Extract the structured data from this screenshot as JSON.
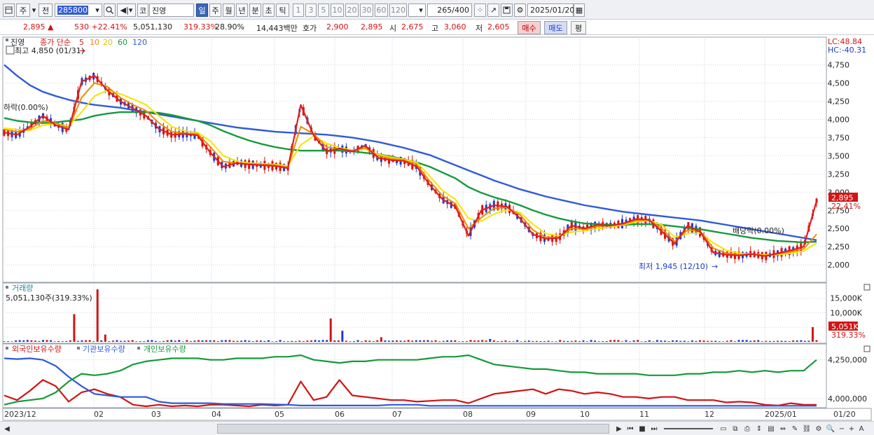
{
  "toolbar": {
    "period_label": "주",
    "prev_label": "전",
    "code_value": "285800",
    "market_label": "코",
    "stock_name": "진영",
    "tabs": [
      "일",
      "주",
      "월",
      "년",
      "분",
      "초",
      "틱"
    ],
    "active_tab": "일",
    "intervals": [
      "1",
      "3",
      "5",
      "10",
      "20",
      "30",
      "60",
      "120"
    ],
    "count_display": "265",
    "count_total": "/400",
    "date_value": "2025/01/20"
  },
  "quote": {
    "price": "2,895 ▲",
    "change": "530 +22.41%",
    "volume": "5,051,130",
    "volume_ratio": "319.33%",
    "turnover": "28.90%",
    "trade_value": "14,443백만",
    "ask_label": "호가",
    "ask_price": "2,900",
    "bid_price": "2,895",
    "open_label": "시",
    "open": "2,675",
    "high_label": "고",
    "high": "3,060",
    "low_label": "저",
    "low": "2,605",
    "buy_label": "매수",
    "sell_label": "매도",
    "eval_label": "평"
  },
  "price_panel": {
    "title": "진영",
    "legend_prefix": "종가 단순",
    "ma_periods": [
      "5",
      "10",
      "20",
      "60",
      "120"
    ],
    "ma_colors": [
      "#e21e1e",
      "#f08a00",
      "#f5e400",
      "#179a3c",
      "#2f5bd8"
    ],
    "high_marker": "최고 4,850 (01/31)",
    "low_marker": "최저 1,945 (12/10)",
    "down_marker": "하락(0.00%)",
    "div_marker": "배당락(0.00%)",
    "lc": "LC:48.84",
    "hc": "HC:-40.31",
    "price_tag": "2,895",
    "pct_tag": "22.41%"
  },
  "volume_panel": {
    "title": "거래량",
    "reading": "5,051,130주(319.33%)",
    "vol_tag": "5,051K",
    "pct_tag": "319.33%"
  },
  "holdings_panel": {
    "legend": [
      {
        "label": "외국인보유수량",
        "color": "#d11414"
      },
      {
        "label": "기관보유수량",
        "color": "#2f5bd8"
      },
      {
        "label": "개인보유수량",
        "color": "#179a3c"
      }
    ]
  },
  "x_axis": {
    "labels": [
      "2023/12",
      "02",
      "03",
      "04",
      "05",
      "06",
      "07",
      "08",
      "09",
      "10",
      "11",
      "12",
      "2025/01"
    ],
    "right_label": "01/20"
  },
  "chart_data": [
    {
      "type": "line",
      "title": "진영",
      "y_ticks": [
        4750,
        4500,
        4250,
        4000,
        3750,
        3500,
        3250,
        3000,
        2750,
        2500,
        2250,
        2000
      ],
      "ylim": [
        1780,
        4900
      ],
      "series": [
        {
          "name": "5",
          "color": "#e21e1e",
          "values": [
            3820,
            3790,
            3900,
            4050,
            3920,
            3860,
            4520,
            4600,
            4400,
            4250,
            4150,
            4050,
            3870,
            3790,
            3800,
            3780,
            3540,
            3350,
            3400,
            3380,
            3370,
            3360,
            3330,
            4200,
            3780,
            3560,
            3600,
            3560,
            3640,
            3470,
            3440,
            3430,
            3350,
            3100,
            2900,
            2800,
            2400,
            2750,
            2820,
            2800,
            2640,
            2420,
            2360,
            2370,
            2540,
            2500,
            2550,
            2540,
            2570,
            2630,
            2620,
            2460,
            2290,
            2540,
            2450,
            2170,
            2140,
            2130,
            2150,
            2120,
            2160,
            2200,
            2250,
            2880
          ]
        },
        {
          "name": "10",
          "color": "#f08a00",
          "values": [
            3860,
            3830,
            3870,
            3980,
            3950,
            3880,
            4300,
            4500,
            4450,
            4300,
            4200,
            4120,
            3950,
            3830,
            3810,
            3800,
            3620,
            3420,
            3400,
            3390,
            3380,
            3370,
            3340,
            3900,
            3800,
            3620,
            3590,
            3570,
            3610,
            3500,
            3460,
            3440,
            3380,
            3150,
            2950,
            2840,
            2500,
            2650,
            2780,
            2790,
            2690,
            2480,
            2380,
            2380,
            2500,
            2490,
            2530,
            2540,
            2560,
            2610,
            2620,
            2500,
            2320,
            2480,
            2460,
            2230,
            2160,
            2140,
            2150,
            2130,
            2150,
            2180,
            2220,
            2420
          ]
        },
        {
          "name": "20",
          "color": "#f5e400",
          "values": [
            3880,
            3860,
            3850,
            3920,
            3940,
            3910,
            4100,
            4320,
            4400,
            4350,
            4280,
            4200,
            4050,
            3900,
            3840,
            3820,
            3700,
            3500,
            3430,
            3400,
            3390,
            3380,
            3360,
            3650,
            3770,
            3670,
            3610,
            3580,
            3590,
            3520,
            3480,
            3450,
            3410,
            3220,
            3020,
            2900,
            2640,
            2600,
            2700,
            2760,
            2720,
            2560,
            2430,
            2400,
            2450,
            2470,
            2500,
            2520,
            2550,
            2590,
            2610,
            2550,
            2380,
            2430,
            2440,
            2300,
            2200,
            2160,
            2150,
            2140,
            2140,
            2160,
            2190,
            2300
          ]
        },
        {
          "name": "60",
          "color": "#179a3c",
          "values": [
            4020,
            3980,
            3960,
            3950,
            3960,
            3980,
            4000,
            4050,
            4080,
            4100,
            4100,
            4100,
            4090,
            4060,
            4020,
            3980,
            3920,
            3840,
            3770,
            3710,
            3660,
            3620,
            3590,
            3570,
            3570,
            3570,
            3570,
            3560,
            3540,
            3520,
            3490,
            3450,
            3410,
            3350,
            3270,
            3190,
            3070,
            2990,
            2930,
            2880,
            2820,
            2750,
            2690,
            2640,
            2600,
            2570,
            2560,
            2550,
            2550,
            2560,
            2560,
            2550,
            2530,
            2510,
            2490,
            2460,
            2430,
            2400,
            2370,
            2350,
            2330,
            2320,
            2310,
            2320
          ]
        },
        {
          "name": "120",
          "color": "#2f5bd8",
          "values": [
            4750,
            4600,
            4470,
            4380,
            4320,
            4270,
            4230,
            4200,
            4180,
            4160,
            4130,
            4100,
            4070,
            4040,
            4010,
            3980,
            3950,
            3920,
            3890,
            3870,
            3850,
            3830,
            3820,
            3810,
            3800,
            3790,
            3770,
            3750,
            3720,
            3690,
            3650,
            3610,
            3560,
            3510,
            3440,
            3370,
            3300,
            3230,
            3160,
            3100,
            3040,
            2990,
            2940,
            2900,
            2860,
            2820,
            2790,
            2760,
            2730,
            2710,
            2690,
            2670,
            2650,
            2630,
            2610,
            2580,
            2550,
            2520,
            2490,
            2460,
            2430,
            2400,
            2370,
            2340
          ]
        }
      ]
    },
    {
      "type": "bar",
      "title": "거래량",
      "y_ticks": [
        5000,
        10000,
        15000
      ],
      "y_tick_labels": [
        "5,000",
        "10,000K",
        "15,000K"
      ],
      "ylim": [
        0,
        18500
      ],
      "spikes": [
        {
          "i": 18,
          "v": 9500,
          "c": "#d11414"
        },
        {
          "i": 24,
          "v": 18000,
          "c": "#d11414"
        },
        {
          "i": 26,
          "v": 2500,
          "c": "#d11414"
        },
        {
          "i": 84,
          "v": 8000,
          "c": "#d11414"
        },
        {
          "i": 87,
          "v": 3800,
          "c": "#1f3cc9"
        },
        {
          "i": 97,
          "v": 1600,
          "c": "#d11414"
        },
        {
          "i": 125,
          "v": 1000,
          "c": "#1f3cc9"
        },
        {
          "i": 208,
          "v": 5051,
          "c": "#d11414"
        }
      ]
    },
    {
      "type": "line",
      "title": "보유수량",
      "y_ticks": [
        4000000,
        4250000
      ],
      "y_tick_labels": [
        "4,000,000",
        "4,250,000"
      ],
      "ylim": [
        3950000,
        4330000
      ],
      "series": [
        {
          "name": "외국인보유수량",
          "color": "#d11414",
          "values": [
            4020000,
            3990000,
            4050000,
            4120000,
            4080000,
            3980000,
            4040000,
            4060000,
            4030000,
            4010000,
            3960000,
            3950000,
            3960000,
            3950000,
            3955000,
            3950000,
            3960000,
            3960000,
            3955000,
            3950000,
            3960000,
            3955000,
            3960000,
            4110000,
            3990000,
            4010000,
            4120000,
            4020000,
            4010000,
            4000000,
            3990000,
            3990000,
            3980000,
            3985000,
            3990000,
            3990000,
            3970000,
            4000000,
            4030000,
            4040000,
            4050000,
            4060000,
            4030000,
            4060000,
            4050000,
            4030000,
            4040000,
            4030000,
            4010000,
            4010000,
            4000000,
            4010000,
            4010000,
            3990000,
            3990000,
            3990000,
            3975000,
            3980000,
            3975000,
            3960000,
            3955000,
            3970000,
            3960000,
            3960000
          ]
        },
        {
          "name": "기관보유수량",
          "color": "#2f5bd8",
          "values": [
            4260000,
            4255000,
            4260000,
            4250000,
            4210000,
            4140000,
            4080000,
            4030000,
            4020000,
            4010000,
            4010000,
            4010000,
            3980000,
            3970000,
            3970000,
            3970000,
            3970000,
            3965000,
            3965000,
            3965000,
            3965000,
            3962000,
            3960000,
            3955000,
            3955000,
            3955000,
            3955000,
            3955000,
            3955000,
            3955000,
            3960000,
            3960000,
            3960000,
            3953000,
            3953000,
            3953000,
            3953000,
            3953000,
            3953000,
            3953000,
            3953000,
            3953000,
            3953000,
            3953000,
            3953000,
            3953000,
            3953000,
            3953000,
            3953000,
            3953000,
            3953000,
            3953000,
            3953000,
            3953000,
            3953000,
            3953000,
            3953000,
            3953000,
            3953000,
            3953000,
            3953000,
            3953000,
            3953000,
            3953000
          ]
        },
        {
          "name": "개인보유수량",
          "color": "#179a3c",
          "values": [
            3960000,
            3980000,
            3990000,
            4000000,
            4040000,
            4110000,
            4160000,
            4150000,
            4160000,
            4180000,
            4220000,
            4240000,
            4250000,
            4260000,
            4260000,
            4260000,
            4250000,
            4250000,
            4260000,
            4260000,
            4260000,
            4270000,
            4270000,
            4280000,
            4250000,
            4240000,
            4230000,
            4240000,
            4240000,
            4250000,
            4250000,
            4250000,
            4250000,
            4260000,
            4270000,
            4270000,
            4280000,
            4250000,
            4220000,
            4210000,
            4200000,
            4190000,
            4190000,
            4180000,
            4170000,
            4170000,
            4160000,
            4160000,
            4160000,
            4160000,
            4150000,
            4150000,
            4150000,
            4160000,
            4160000,
            4170000,
            4170000,
            4180000,
            4170000,
            4180000,
            4170000,
            4180000,
            4180000,
            4250000
          ]
        }
      ]
    }
  ]
}
